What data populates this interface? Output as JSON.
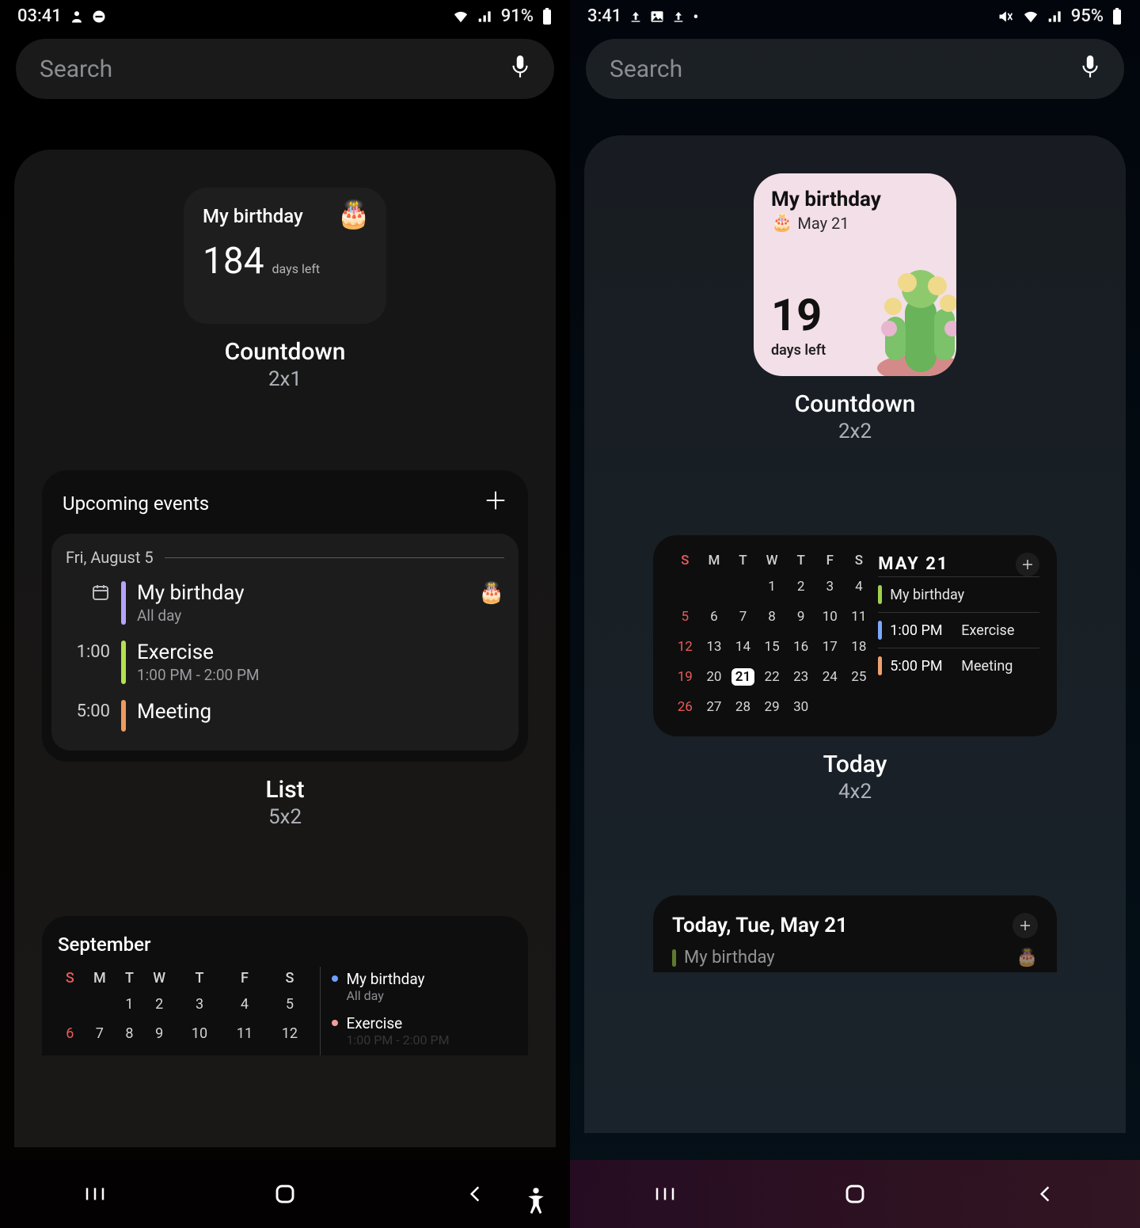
{
  "left": {
    "status": {
      "time": "03:41",
      "battery": "91%"
    },
    "search": {
      "placeholder": "Search"
    },
    "countdown": {
      "title": "My birthday",
      "count": "184",
      "days_left": "days left",
      "widget_title": "Countdown",
      "widget_size": "2x1"
    },
    "list": {
      "header": "Upcoming events",
      "date": "Fri, August 5",
      "events": [
        {
          "time_icon": true,
          "name": "My birthday",
          "sub": "All day",
          "bar": "purple",
          "emoji": "🎂"
        },
        {
          "time": "1:00",
          "name": "Exercise",
          "sub": "1:00 PM - 2:00 PM",
          "bar": "green"
        },
        {
          "time": "5:00",
          "name": "Meeting",
          "bar": "orange"
        }
      ],
      "widget_title": "List",
      "widget_size": "5x2"
    },
    "month": {
      "title": "September",
      "dow": [
        "S",
        "M",
        "T",
        "W",
        "T",
        "F",
        "S"
      ],
      "rows": [
        [
          "",
          "",
          "1",
          "2",
          "3",
          "4",
          "5"
        ],
        [
          "6",
          "7",
          "8",
          "9",
          "10",
          "11",
          "12"
        ]
      ],
      "agenda": [
        {
          "name": "My birthday",
          "sub": "All day",
          "dot": "blue"
        },
        {
          "name": "Exercise",
          "sub": "1:00 PM - 2:00 PM",
          "dot": "pink"
        }
      ]
    }
  },
  "right": {
    "status": {
      "time": "3:41",
      "battery": "95%"
    },
    "search": {
      "placeholder": "Search"
    },
    "countdown": {
      "title": "My birthday",
      "date": "May 21",
      "count": "19",
      "days_left": "days left",
      "widget_title": "Countdown",
      "widget_size": "2x2"
    },
    "today": {
      "month": "MAY 21",
      "dow": [
        "S",
        "M",
        "T",
        "W",
        "T",
        "F",
        "S"
      ],
      "grid": [
        [
          "",
          "",
          "",
          "1",
          "2",
          "3",
          "4"
        ],
        [
          "5",
          "6",
          "7",
          "8",
          "9",
          "10",
          "11"
        ],
        [
          "12",
          "13",
          "14",
          "15",
          "16",
          "17",
          "18"
        ],
        [
          "19",
          "20",
          "21",
          "22",
          "23",
          "24",
          "25"
        ],
        [
          "26",
          "27",
          "28",
          "29",
          "30",
          "",
          ""
        ]
      ],
      "today_cell": "21",
      "events": [
        {
          "bar": "green",
          "time": "",
          "name": "My birthday"
        },
        {
          "bar": "blue",
          "time": "1:00 PM",
          "name": "Exercise"
        },
        {
          "bar": "orange",
          "time": "5:00 PM",
          "name": "Meeting"
        }
      ],
      "widget_title": "Today",
      "widget_size": "4x2"
    },
    "today_list": {
      "header": "Today, Tue, May 21",
      "event": {
        "name": "My birthday"
      }
    }
  }
}
